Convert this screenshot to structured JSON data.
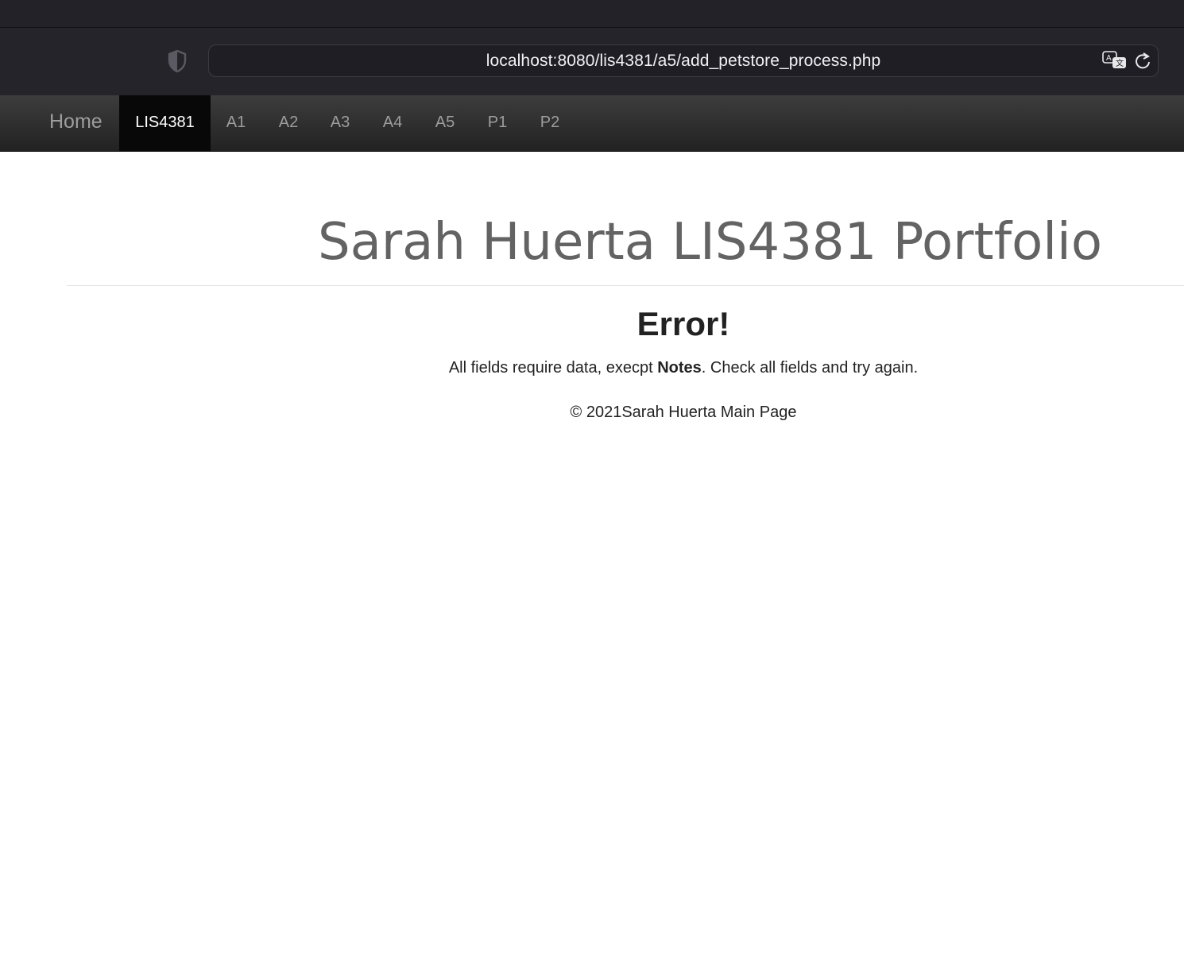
{
  "browser": {
    "url": "localhost:8080/lis4381/a5/add_petstore_process.php",
    "icons": [
      "shield-icon",
      "translate-icon",
      "reload-icon"
    ]
  },
  "navbar": {
    "brand": "Home",
    "items": [
      {
        "label": "LIS4381",
        "active": true
      },
      {
        "label": "A1",
        "active": false
      },
      {
        "label": "A2",
        "active": false
      },
      {
        "label": "A3",
        "active": false
      },
      {
        "label": "A4",
        "active": false
      },
      {
        "label": "A5",
        "active": false
      },
      {
        "label": "P1",
        "active": false
      },
      {
        "label": "P2",
        "active": false
      }
    ]
  },
  "page": {
    "title": "Sarah Huerta LIS4381 Portfolio",
    "error_heading": "Error!",
    "error_prefix": "All fields require data, execpt ",
    "error_bold": "Notes",
    "error_suffix": ". Check all fields and try again.",
    "footer": "© 2021Sarah Huerta Main Page"
  }
}
